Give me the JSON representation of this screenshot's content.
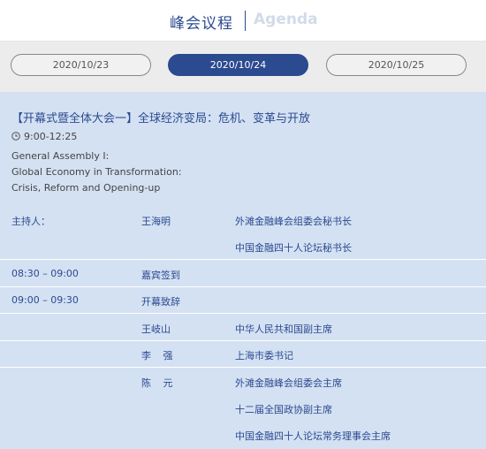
{
  "header": {
    "title_cn": "峰会议程",
    "title_en": "Agenda"
  },
  "tabs": [
    {
      "label": "2020/10/23",
      "active": false
    },
    {
      "label": "2020/10/24",
      "active": true
    },
    {
      "label": "2020/10/25",
      "active": false
    }
  ],
  "session": {
    "title": "【开幕式暨全体大会一】全球经济变局：危机、变革与开放",
    "time_icon": "clock-icon",
    "time": "9:00-12:25",
    "en_lines": [
      "General Assembly I:",
      "Global Economy in Transformation:",
      "Crisis, Reform and Opening-up"
    ]
  },
  "rows": [
    {
      "c1": "主持人：",
      "c2": "王海明",
      "c3": "外滩金融峰会组委会秘书长"
    },
    {
      "c1": "",
      "c2": "",
      "c3": "中国金融四十人论坛秘书长"
    },
    {
      "c1": "08:30 – 09:00",
      "c2": "嘉宾签到",
      "c3": ""
    },
    {
      "c1": "09:00 – 09:30",
      "c2": "开幕致辞",
      "c3": ""
    },
    {
      "c1": "",
      "c2": "王岐山",
      "c3": "中华人民共和国副主席"
    },
    {
      "c1": "",
      "c2": "李 强",
      "c3": "上海市委书记"
    },
    {
      "c1": "",
      "c2": "陈 元",
      "c3": "外滩金融峰会组委会主席"
    },
    {
      "c1": "",
      "c2": "",
      "c3": "十二届全国政协副主席"
    },
    {
      "c1": "",
      "c2": "",
      "c3": "中国金融四十人论坛常务理事会主席"
    }
  ],
  "colors": {
    "accent": "#2b4a8f",
    "content_bg": "#d4e1f3",
    "tab_bar_bg": "#ececec",
    "agenda_en_color": "#d2dbe9"
  }
}
